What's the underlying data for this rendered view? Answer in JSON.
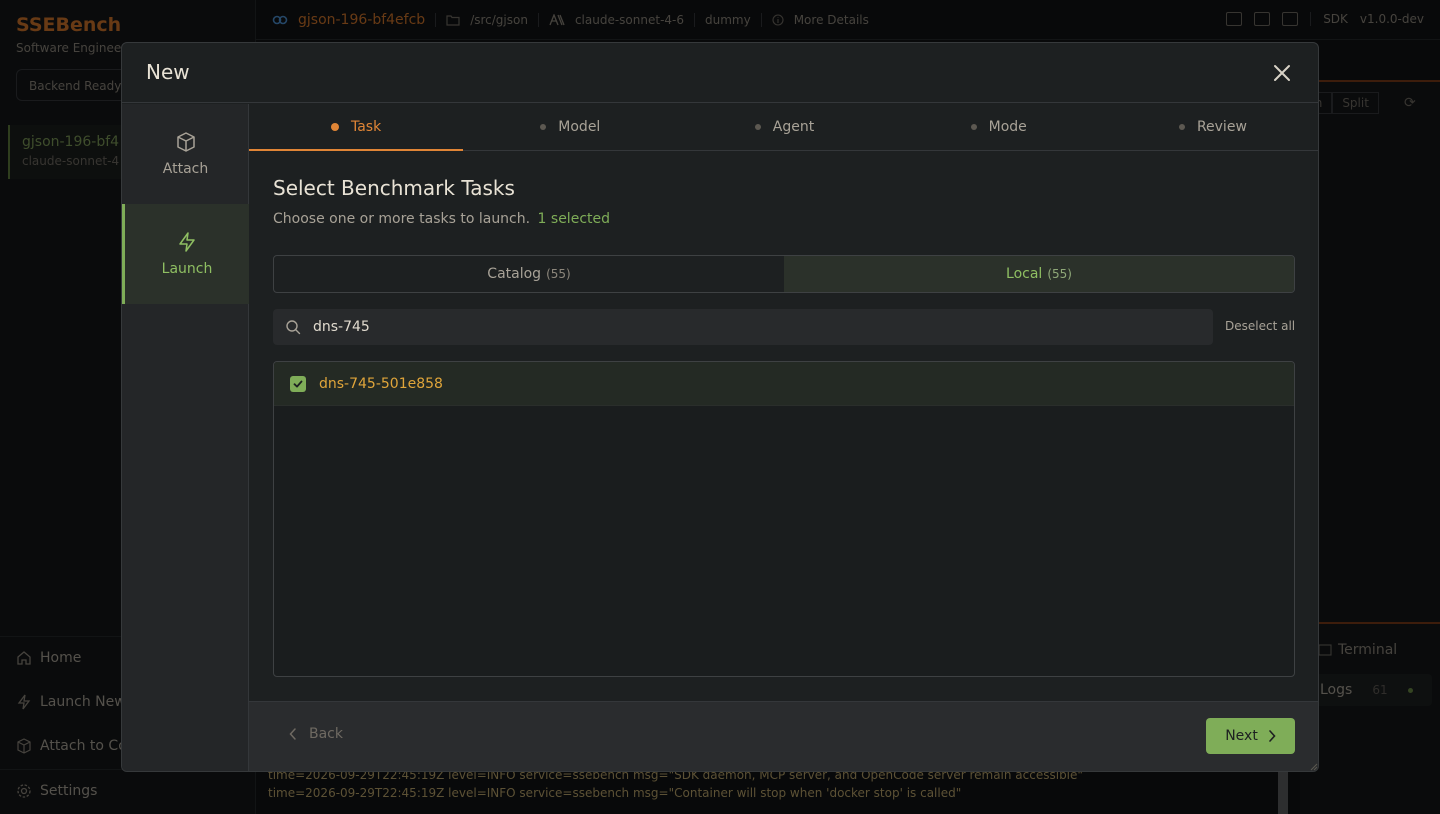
{
  "background": {
    "brand": "SSEBench",
    "brand_subtitle": "Software Enginee",
    "backend_status": "Backend Ready",
    "session": {
      "title": "gjson-196-bf4",
      "subtitle": "claude-sonnet-4"
    },
    "nav": {
      "home": "Home",
      "launch_new": "Launch New",
      "attach": "Attach to Co",
      "settings": "Settings"
    },
    "topbar": {
      "title": "gjson-196-bf4efcb",
      "path": "/src/gjson",
      "model": "claude-sonnet-4-6",
      "agent": "dummy",
      "more_details": "More Details",
      "sdk_label": "SDK",
      "sdk_version": "v1.0.0-dev"
    },
    "view_modes": [
      "th",
      "Split"
    ],
    "terminal_tab": "Terminal",
    "logs_tab": "Logs",
    "logs_count": "61",
    "log_lines": [
      "time=2026-09-29T22:45:19Z level=INFO service=ssebench msg=\"SDK daemon, MCP server, and OpenCode server remain accessible\"",
      "time=2026-09-29T22:45:19Z level=INFO service=ssebench msg=\"Container will stop when 'docker stop' is called\""
    ]
  },
  "modal": {
    "title": "New",
    "side": {
      "attach": "Attach",
      "launch": "Launch"
    },
    "steps": [
      "Task",
      "Model",
      "Agent",
      "Mode",
      "Review"
    ],
    "active_step": "Task",
    "section_title": "Select Benchmark Tasks",
    "section_subtitle": "Choose one or more tasks to launch.",
    "selected_label": "1 selected",
    "tabs": {
      "catalog": {
        "label": "Catalog",
        "count": "(55)"
      },
      "local": {
        "label": "Local",
        "count": "(55)"
      }
    },
    "active_tab": "Local",
    "search": {
      "value": "dns-745",
      "placeholder": ""
    },
    "deselect_all": "Deselect all",
    "tasks": [
      {
        "name": "dns-745-501e858",
        "checked": true
      }
    ],
    "footer": {
      "back": "Back",
      "next": "Next"
    }
  },
  "colors": {
    "accent_orange": "#e08536",
    "accent_green": "#7fad58",
    "task_text": "#e0a53a"
  }
}
